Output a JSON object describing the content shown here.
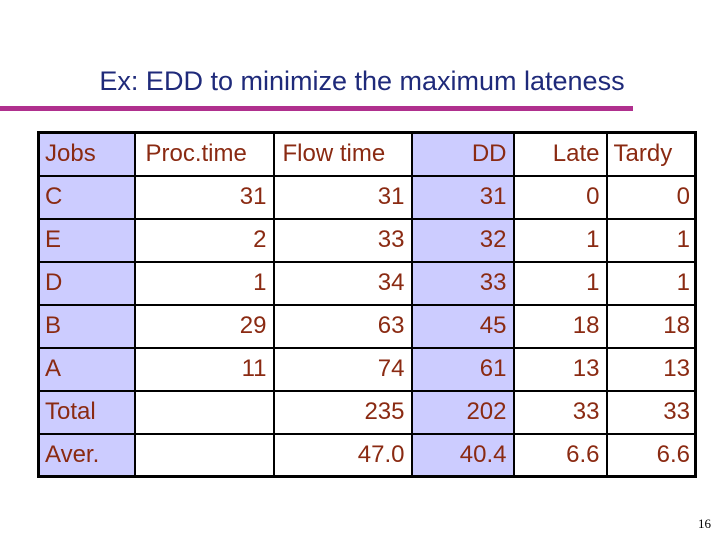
{
  "title": "Ex: EDD to minimize the maximum lateness",
  "table": {
    "headers": [
      "Jobs",
      "Proc.time",
      "Flow time",
      "DD",
      "Late",
      "Tardy"
    ],
    "rows": [
      [
        "C",
        "31",
        "31",
        "31",
        "0",
        "0"
      ],
      [
        "E",
        "2",
        "33",
        "32",
        "1",
        "1"
      ],
      [
        "D",
        "1",
        "34",
        "33",
        "1",
        "1"
      ],
      [
        "B",
        "29",
        "63",
        "45",
        "18",
        "18"
      ],
      [
        "A",
        "11",
        "74",
        "61",
        "13",
        "13"
      ],
      [
        "Total",
        "",
        "235",
        "202",
        "33",
        "33"
      ],
      [
        "Aver.",
        "",
        "47.0",
        "40.4",
        "6.6",
        "6.6"
      ]
    ]
  },
  "page_number": "16",
  "colors": {
    "title": "#1f2a7a",
    "rule": "#b0308e",
    "cell_text": "#8a2a12",
    "highlight_column": "#ccccff"
  }
}
